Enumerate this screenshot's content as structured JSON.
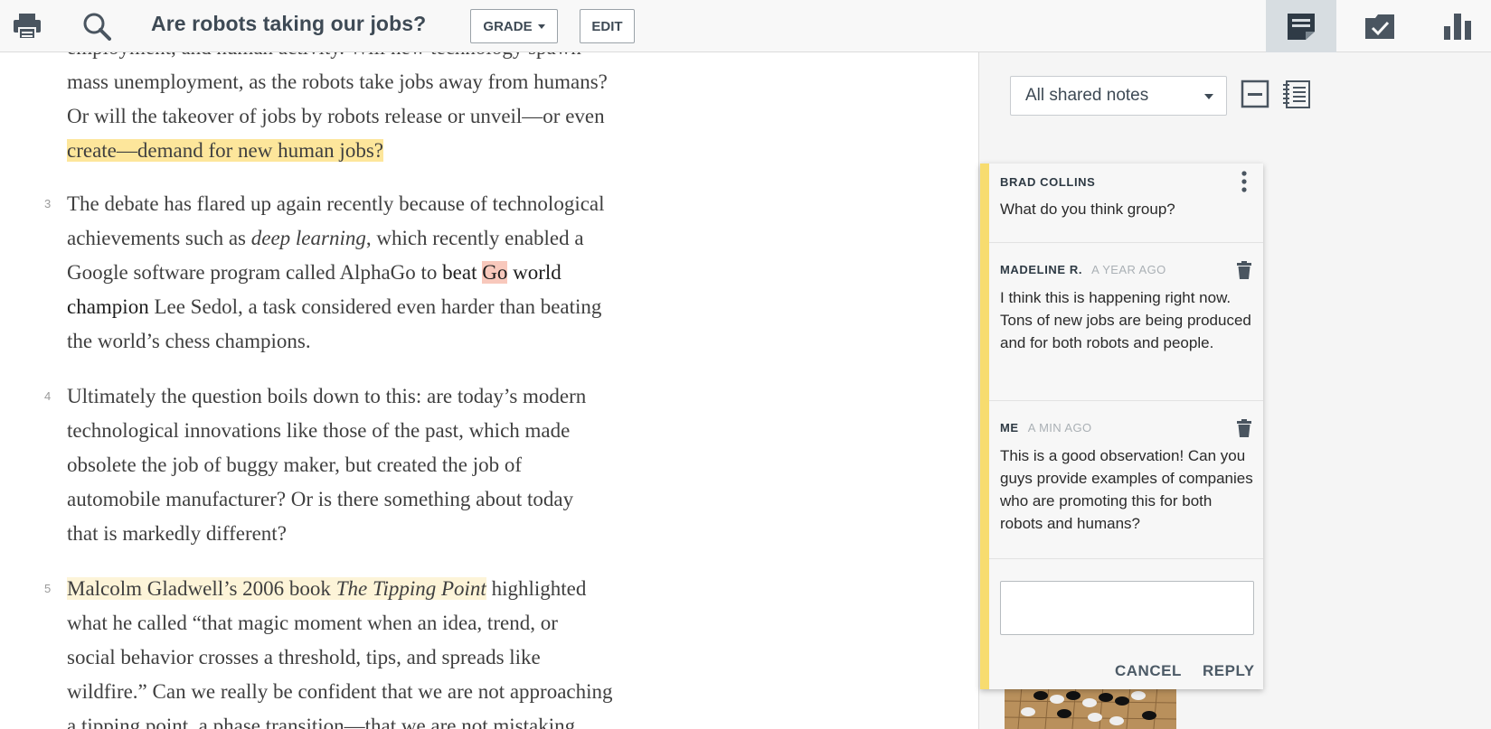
{
  "topbar": {
    "print_icon": "printer-icon",
    "search_icon": "magnifier-icon",
    "title": "Are robots taking our jobs?",
    "grade_label": "GRADE",
    "edit_label": "EDIT",
    "tabs": [
      {
        "icon": "notes-icon",
        "active": true
      },
      {
        "icon": "assignment-check-icon",
        "active": false
      },
      {
        "icon": "bar-chart-icon",
        "active": false
      }
    ]
  },
  "reader": {
    "p2_top": "employment, and human activity. Will new technology spawn",
    "p2_l1": "mass unemployment, as the robots take jobs away from humans?",
    "p2_l2": "Or will the takeover of jobs by robots release or unveil—or even",
    "p2_l3_hl": "create—demand for new human jobs?",
    "p3_num": "3",
    "p3_l1": "The debate has flared up again recently because of technological",
    "p3_l2a": "achievements such as ",
    "p3_l2b": "deep learning",
    "p3_l2c": ", which recently enabled a",
    "p3_l3a": "Google software program called AlphaGo to ",
    "p3_l3b": "beat ",
    "p3_l3c": "Go",
    "p3_l3d": " world",
    "p3_l4a": "champion",
    "p3_l4b": " Lee Sedol, a task considered even harder than beating",
    "p3_l5": "the world’s chess champions.",
    "p4_num": "4",
    "p4_l1": "Ultimately the question boils down to this: are today’s modern",
    "p4_l2": "technological innovations like those of the past, which made",
    "p4_l3": "obsolete the job of buggy maker, but created the job of",
    "p4_l4": "automobile manufacturer? Or is there something about today",
    "p4_l5": "that is markedly different?",
    "p5_num": "5",
    "p5_l1a": "Malcolm Gladwell’s 2006 book ",
    "p5_l1b": "The Tipping Point",
    "p5_l1c": " highlighted",
    "p5_l2": "what he called “that magic moment when an idea, trend, or",
    "p5_l3": "social behavior crosses a threshold, tips, and spreads like",
    "p5_l4": "wildfire.” Can we really be confident that we are not approaching",
    "p5_l5": "a tipping point, a phase transition—that we are not mistaking"
  },
  "panel": {
    "filter_value": "All shared notes",
    "collapse_icon": "collapse-minus-icon",
    "notebook_icon": "notebook-icon",
    "notes": [
      {
        "author": "BRAD COLLINS",
        "time": "",
        "body": "What do you think group?",
        "action_icon": "more-vertical-icon"
      },
      {
        "author": "MADELINE R.",
        "time": "A YEAR AGO",
        "body": "I think this is happening right now. Tons of new jobs are being produced and for both robots and people.",
        "action_icon": "trash-icon"
      },
      {
        "author": "ME",
        "time": "A MIN AGO",
        "body": "This is a good observation! Can you guys provide examples of companies who are promoting this for both robots and humans?",
        "action_icon": "trash-icon"
      }
    ],
    "reply_placeholder": "",
    "cancel_label": "CANCEL",
    "reply_label": "REPLY"
  }
}
